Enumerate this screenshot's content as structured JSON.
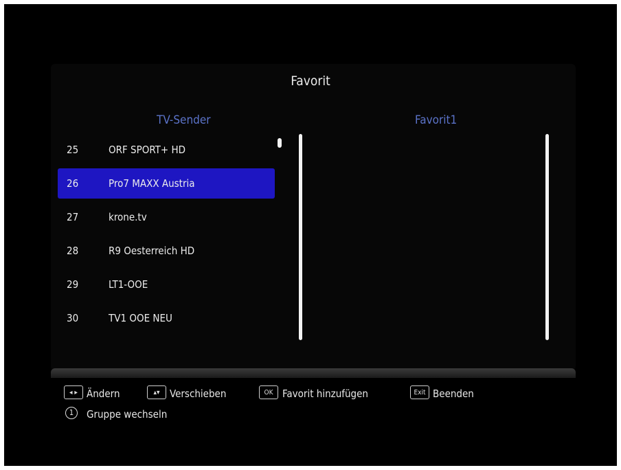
{
  "title": "Favorit",
  "left_header": "TV-Sender",
  "right_header": "Favorit1",
  "channels": [
    {
      "num": "25",
      "name": "ORF SPORT+ HD"
    },
    {
      "num": "26",
      "name": "Pro7 MAXX Austria"
    },
    {
      "num": "27",
      "name": "krone.tv"
    },
    {
      "num": "28",
      "name": "R9 Oesterreich HD"
    },
    {
      "num": "29",
      "name": "LT1-OOE"
    },
    {
      "num": "30",
      "name": "TV1 OOE NEU"
    }
  ],
  "selected_channel_num": "26",
  "footer": {
    "key_change": "◂ ▸",
    "change_label": "Ändern",
    "key_move": "▴▾",
    "move_label": "Verschieben",
    "key_ok": "OK",
    "ok_label": "Favorit hinzufügen",
    "key_exit": "Exit",
    "exit_label": "Beenden",
    "key_group": "1",
    "group_label": "Gruppe wechseln"
  },
  "colors": {
    "selection": "#1e16c2",
    "header_text": "#5b73c9",
    "background": "#000000"
  }
}
